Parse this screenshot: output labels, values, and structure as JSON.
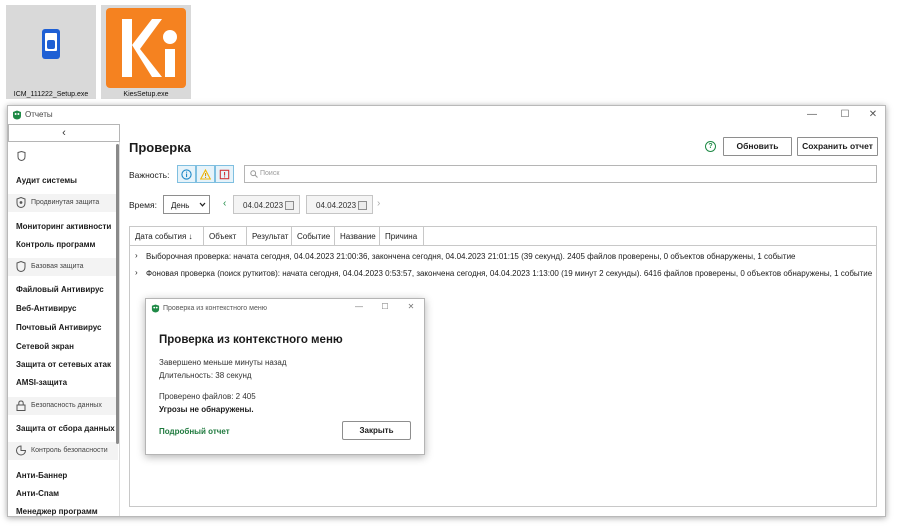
{
  "desktop": {
    "icons": [
      {
        "label": "ICM_111222_Setup.exe",
        "icon": "icm-setup-icon"
      },
      {
        "label": "KiesSetup.exe",
        "icon": "kies-setup-icon",
        "brand_color": "#f58220"
      }
    ]
  },
  "window": {
    "title": "Отчеты",
    "controls": {
      "minimize": "—",
      "maximize": "☐",
      "close": "✕"
    }
  },
  "sidebar": {
    "collapse": "‹",
    "top_items": [
      {
        "label": "Аудит системы"
      }
    ],
    "groups": [
      {
        "label": "Продвинутая защита",
        "items": [
          "Мониторинг активности",
          "Контроль программ"
        ]
      },
      {
        "label": "Базовая защита",
        "items": [
          "Файловый Антивирус",
          "Веб-Антивирус",
          "Почтовый Антивирус",
          "Сетевой экран",
          "Защита от сетевых атак",
          "AMSI-защита"
        ]
      },
      {
        "label": "Безопасность данных",
        "items": [
          "Защита от сбора данных"
        ]
      },
      {
        "label": "Контроль безопасности",
        "items": [
          "Анти-Баннер",
          "Анти-Спам",
          "Менеджер программ"
        ]
      }
    ]
  },
  "main": {
    "title": "Проверка",
    "help": "?",
    "refresh_label": "Обновить",
    "save_label": "Сохранить отчет",
    "severity_label": "Важность:",
    "search_placeholder": "Поиск",
    "time_label": "Время:",
    "period": "День",
    "date_from": "04.04.2023",
    "date_to": "04.04.2023",
    "prev": "‹",
    "next": "›",
    "columns": [
      "Дата события ↓",
      "Объект",
      "Результат",
      "Событие",
      "Название",
      "Причина"
    ],
    "rows": [
      "Выборочная проверка: начата сегодня, 04.04.2023 21:00:36, закончена сегодня, 04.04.2023 21:01:15 (39 секунд). 2405 файлов проверены, 0 объектов обнаружены, 1 событие",
      "Фоновая проверка (поиск руткитов): начата сегодня, 04.04.2023 0:53:57, закончена сегодня, 04.04.2023 1:13:00 (19 минут 2 секунды). 6416 файлов проверены, 0 объектов обнаружены, 1 событие"
    ]
  },
  "dialog": {
    "window_title": "Проверка из контекстного меню",
    "heading": "Проверка из контекстного меню",
    "line1": "Завершено меньше минуты назад",
    "line2": "Длительность: 38 секунд",
    "line3": "Проверено файлов: 2 405",
    "line4": "Угрозы не обнаружены.",
    "link": "Подробный отчет",
    "close_label": "Закрыть",
    "controls": {
      "minimize": "—",
      "maximize": "☐",
      "close": "✕"
    }
  },
  "colors": {
    "accent_green": "#1f8a46",
    "info_blue": "#1e88c7",
    "warn_yellow": "#f2b705",
    "error_red": "#d0343a"
  }
}
